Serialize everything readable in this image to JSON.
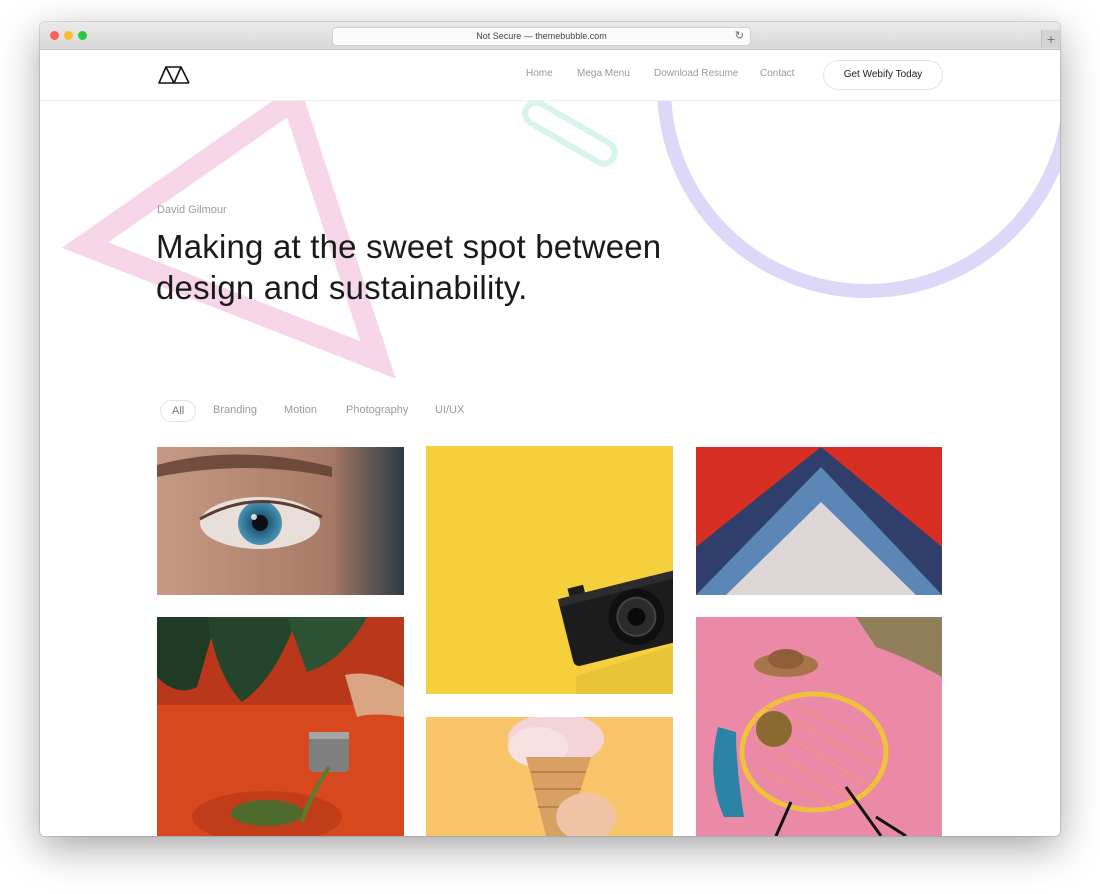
{
  "browser": {
    "address": "Not Secure — themebubble.com"
  },
  "nav": {
    "links": [
      "Home",
      "Mega Menu",
      "Download Resume",
      "Contact"
    ],
    "cta": "Get Webify Today"
  },
  "hero": {
    "name": "David Gilmour",
    "headline_line1": "Making at the sweet spot between",
    "headline_line2": "design and sustainability."
  },
  "filters": [
    "All",
    "Branding",
    "Motion",
    "Photography",
    "UI/UX"
  ],
  "filters_active": "All",
  "portfolio": [
    {
      "subject": "eye-closeup-photo"
    },
    {
      "subject": "camera-on-yellow-photo"
    },
    {
      "subject": "folded-paper-shapes-photo"
    },
    {
      "subject": "pouring-on-orange-photo"
    },
    {
      "subject": "ice-cream-cone-photo"
    },
    {
      "subject": "pink-chair-still-life-photo"
    }
  ],
  "colors": {
    "deco_pink": "#f6d6e8",
    "deco_purple": "#dcd9f8",
    "deco_mint": "#d9f5ea",
    "yellow": "#f6cf3c",
    "orange": "#d8481f"
  }
}
